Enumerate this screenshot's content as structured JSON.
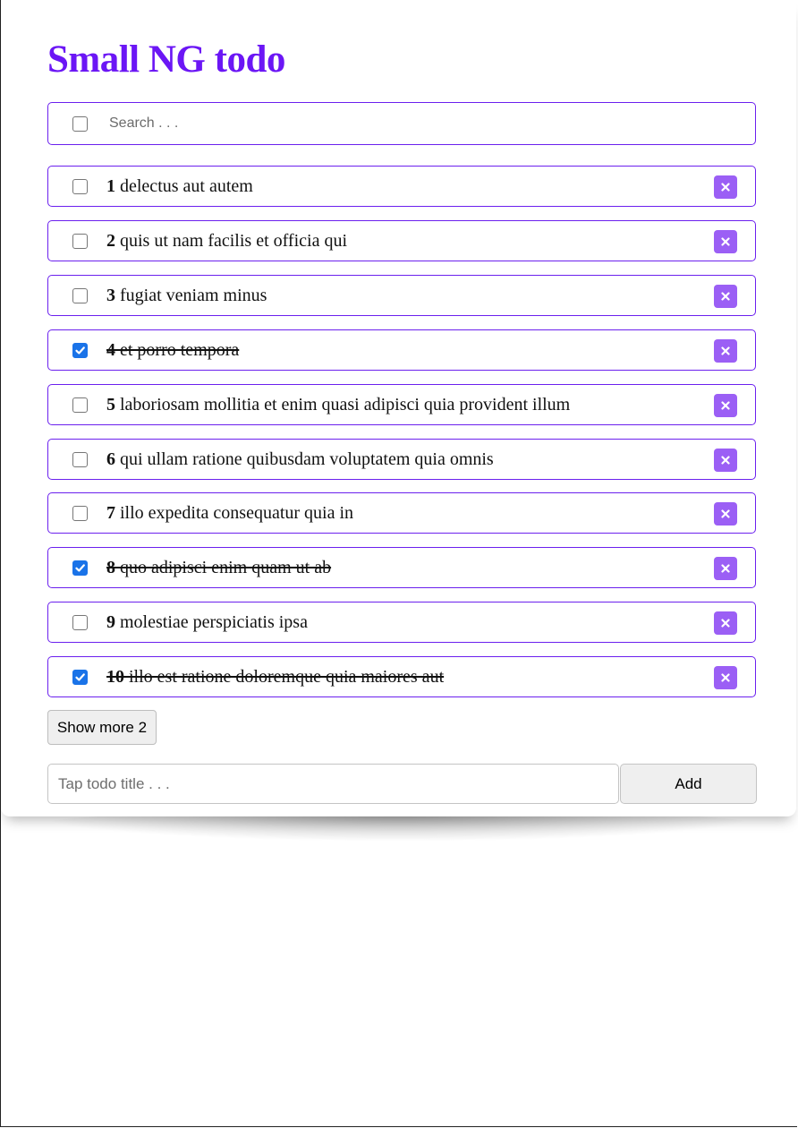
{
  "app": {
    "title": "Small NG todo"
  },
  "search": {
    "placeholder": "Search . . ."
  },
  "todos": [
    {
      "id": "1",
      "title": "delectus aut autem",
      "completed": false
    },
    {
      "id": "2",
      "title": "quis ut nam facilis et officia qui",
      "completed": false
    },
    {
      "id": "3",
      "title": "fugiat veniam minus",
      "completed": false
    },
    {
      "id": "4",
      "title": "et porro tempora",
      "completed": true
    },
    {
      "id": "5",
      "title": "laboriosam mollitia et enim quasi adipisci quia provident illum",
      "completed": false
    },
    {
      "id": "6",
      "title": "qui ullam ratione quibusdam voluptatem quia omnis",
      "completed": false
    },
    {
      "id": "7",
      "title": "illo expedita consequatur quia in",
      "completed": false
    },
    {
      "id": "8",
      "title": "quo adipisci enim quam ut ab",
      "completed": true
    },
    {
      "id": "9",
      "title": "molestiae perspiciatis ipsa",
      "completed": false
    },
    {
      "id": "10",
      "title": "illo est ratione doloremque quia maiores aut",
      "completed": true
    }
  ],
  "show_more": {
    "label": "Show more 2"
  },
  "add_form": {
    "placeholder": "Tap todo title . . .",
    "button_label": "Add"
  },
  "colors": {
    "accent": "#6b16f5",
    "delete_button": "#9b5ff5",
    "checkbox_checked": "#1a73e8"
  }
}
